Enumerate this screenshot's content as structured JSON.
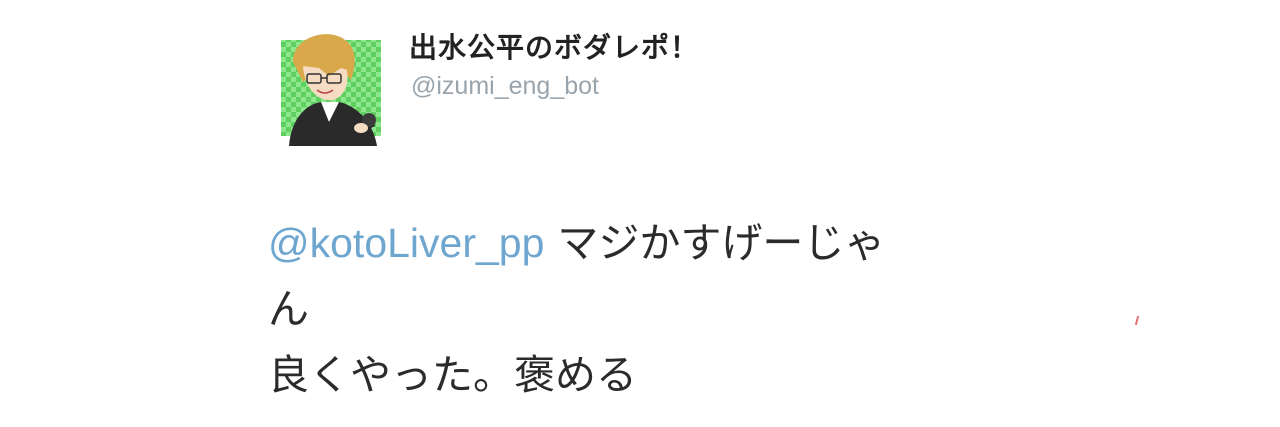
{
  "user": {
    "display_name": "出水公平のボダレポ！",
    "handle": "@izumi_eng_bot"
  },
  "tweet": {
    "mention": "@kotoLiver_pp",
    "line1_text": " マジかすげーじゃ",
    "line2_text": "ん",
    "line3_text": "良くやった。褒める"
  },
  "colors": {
    "mention": "#6fa6cf",
    "handle": "#9aa4ad",
    "text": "#2b2b2b",
    "avatar_bg": "#7fe07f"
  }
}
